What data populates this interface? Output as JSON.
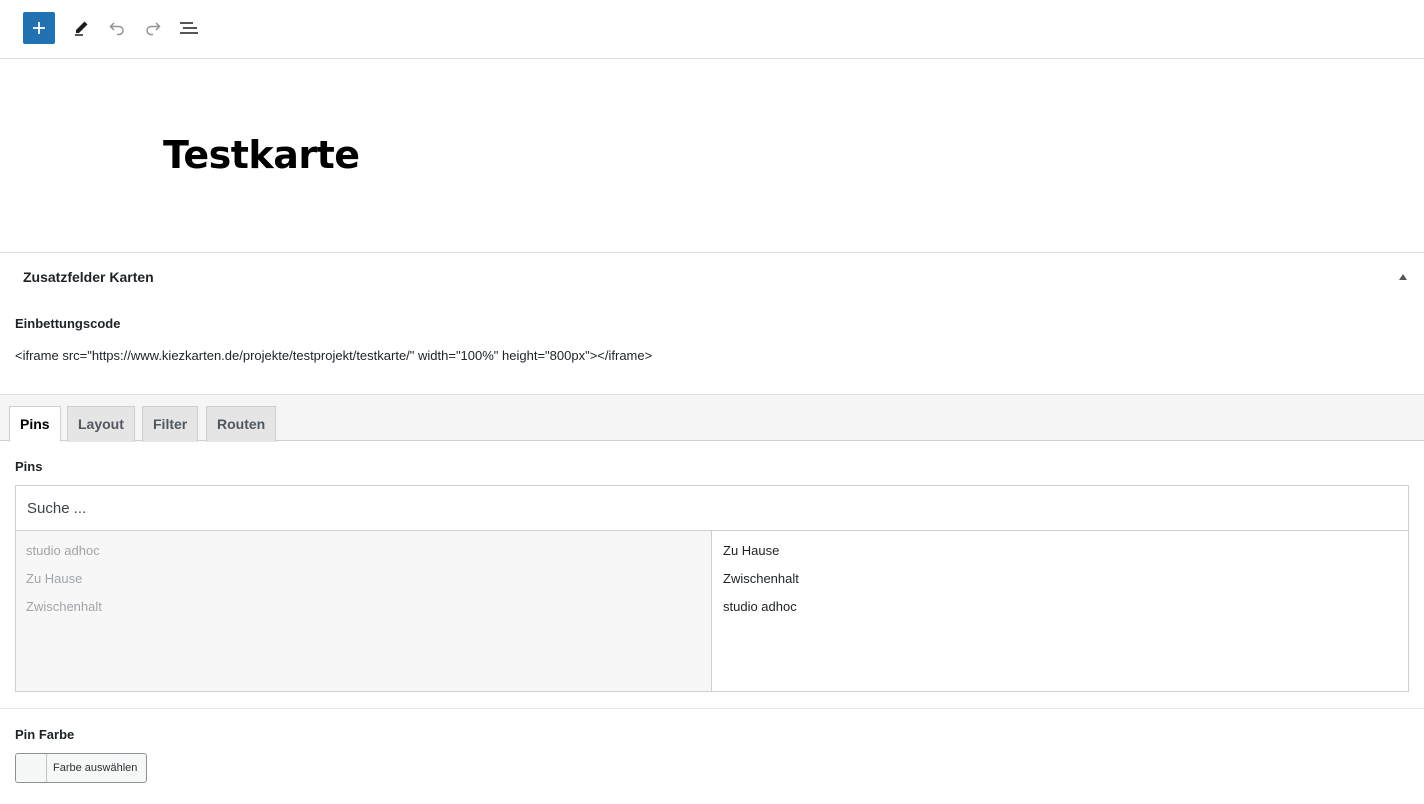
{
  "toolbar": {
    "add_icon": "plus-icon",
    "edit_icon": "pencil-icon",
    "undo_icon": "undo-icon",
    "redo_icon": "redo-icon",
    "list_icon": "list-view-icon",
    "accent_color": "#2271b1"
  },
  "post": {
    "title": "Testkarte"
  },
  "metabox": {
    "title": "Zusatzfelder Karten",
    "toggle_icon": "triangle-up-icon",
    "embed_label": "Einbettungscode",
    "embed_code": "<iframe src=\"https://www.kiezkarten.de/projekte/testprojekt/testkarte/\" width=\"100%\" height=\"800px\"></iframe>"
  },
  "tabs": [
    {
      "label": "Pins",
      "active": true
    },
    {
      "label": "Layout",
      "active": false
    },
    {
      "label": "Filter",
      "active": false
    },
    {
      "label": "Routen",
      "active": false
    }
  ],
  "pins": {
    "label": "Pins",
    "search_placeholder": "Suche ...",
    "choices": [
      "studio adhoc",
      "Zu Hause",
      "Zwischenhalt"
    ],
    "selected": [
      "Zu Hause",
      "Zwischenhalt",
      "studio adhoc"
    ]
  },
  "pin_color": {
    "label": "Pin Farbe",
    "button_label": "Farbe auswählen"
  }
}
